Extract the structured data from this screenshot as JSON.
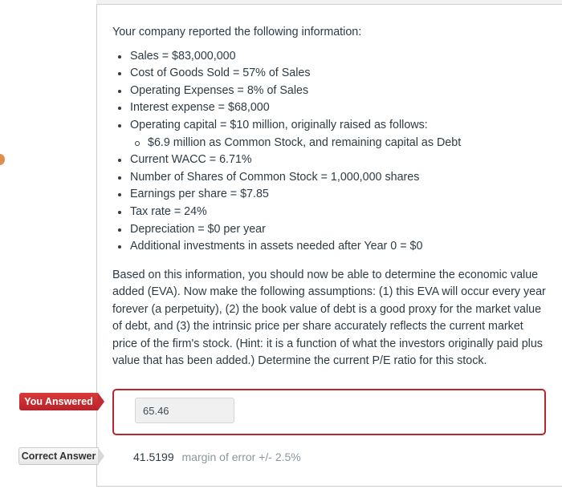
{
  "question": {
    "intro": "Your company reported the following information:",
    "facts": [
      {
        "text": "Sales  =  $83,000,000"
      },
      {
        "text": "Cost of Goods Sold  =  57% of Sales"
      },
      {
        "text": "Operating Expenses = 8% of Sales"
      },
      {
        "text": "Interest expense  =  $68,000"
      },
      {
        "text": "Operating capital = $10 million, originally raised as follows:",
        "sub": [
          "$6.9 million as Common Stock, and remaining capital as Debt"
        ]
      },
      {
        "text": "Current WACC = 6.71%"
      },
      {
        "text": "Number of Shares of Common Stock = 1,000,000 shares"
      },
      {
        "text": "Earnings per share  =  $7.85"
      },
      {
        "text": "Tax rate  =  24%"
      },
      {
        "text": "Depreciation  =  $0 per year"
      },
      {
        "text": "Additional investments in assets needed after Year 0  =  $0"
      }
    ],
    "prompt": "Based on this information, you should now be able to determine the economic value added (EVA).  Now make the following assumptions: (1) this EVA will occur every year forever (a perpetuity), (2) the book value of debt is a good proxy for the market value of debt, and (3) the intrinsic price per share accurately reflects the current market price of the firm's stock.  (Hint: it is a function of what the investors originally paid plus value that has been added.)  Determine the current P/E ratio for this stock."
  },
  "answer": {
    "you_answered_label": "You Answered",
    "your_value": "65.46",
    "correct_label": "Correct Answer",
    "correct_value": "41.5199",
    "margin_text": "margin of error +/- 2.5%"
  },
  "colors": {
    "incorrect": "#b5262f",
    "text": "#2d3b45",
    "muted": "#8b969e"
  }
}
